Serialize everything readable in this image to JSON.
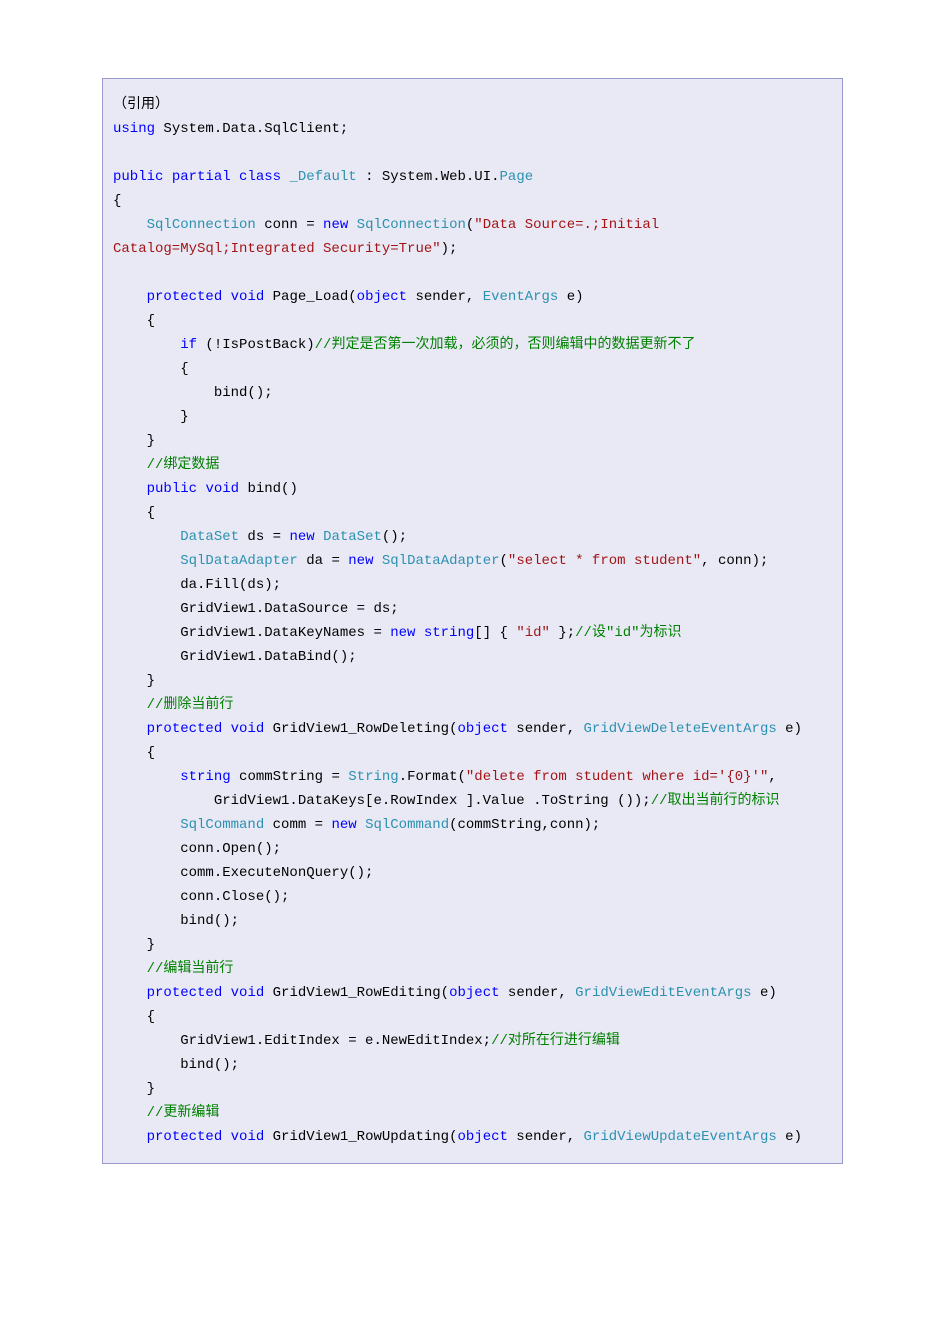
{
  "code": {
    "l01": [
      {
        "t": "（引用）",
        "c": "k-black"
      }
    ],
    "l02": [
      {
        "t": "using",
        "c": "k-blue"
      },
      {
        "t": " System.Data.SqlClient;",
        "c": "k-black"
      }
    ],
    "l03": [
      {
        "t": "",
        "c": "k-black"
      }
    ],
    "l04": [
      {
        "t": "public",
        "c": "k-blue"
      },
      {
        "t": " ",
        "c": "k-black"
      },
      {
        "t": "partial",
        "c": "k-blue"
      },
      {
        "t": " ",
        "c": "k-black"
      },
      {
        "t": "class",
        "c": "k-blue"
      },
      {
        "t": " ",
        "c": "k-black"
      },
      {
        "t": "_Default",
        "c": "k-teal"
      },
      {
        "t": " : System.Web.UI.",
        "c": "k-black"
      },
      {
        "t": "Page",
        "c": "k-teal"
      }
    ],
    "l05": [
      {
        "t": "{",
        "c": "k-black"
      }
    ],
    "l06": [
      {
        "t": "    ",
        "c": "k-black"
      },
      {
        "t": "SqlConnection",
        "c": "k-teal"
      },
      {
        "t": " conn = ",
        "c": "k-black"
      },
      {
        "t": "new",
        "c": "k-blue"
      },
      {
        "t": " ",
        "c": "k-black"
      },
      {
        "t": "SqlConnection",
        "c": "k-teal"
      },
      {
        "t": "(",
        "c": "k-black"
      },
      {
        "t": "\"Data Source=.;Initial ",
        "c": "k-red"
      }
    ],
    "l07": [
      {
        "t": "Catalog=MySql;Integrated Security=True\"",
        "c": "k-red"
      },
      {
        "t": ");",
        "c": "k-black"
      }
    ],
    "l08": [
      {
        "t": "",
        "c": "k-black"
      }
    ],
    "l09": [
      {
        "t": "    ",
        "c": "k-black"
      },
      {
        "t": "protected",
        "c": "k-blue"
      },
      {
        "t": " ",
        "c": "k-black"
      },
      {
        "t": "void",
        "c": "k-blue"
      },
      {
        "t": " Page_Load(",
        "c": "k-black"
      },
      {
        "t": "object",
        "c": "k-blue"
      },
      {
        "t": " sender, ",
        "c": "k-black"
      },
      {
        "t": "EventArgs",
        "c": "k-teal"
      },
      {
        "t": " e)",
        "c": "k-black"
      }
    ],
    "l10": [
      {
        "t": "    {",
        "c": "k-black"
      }
    ],
    "l11": [
      {
        "t": "        ",
        "c": "k-black"
      },
      {
        "t": "if",
        "c": "k-blue"
      },
      {
        "t": " (!IsPostBack)",
        "c": "k-black"
      },
      {
        "t": "//判定是否第一次加载，必须的，否则编辑中的数据更新不了",
        "c": "k-green"
      }
    ],
    "l12": [
      {
        "t": "        {",
        "c": "k-black"
      }
    ],
    "l13": [
      {
        "t": "            bind();",
        "c": "k-black"
      }
    ],
    "l14": [
      {
        "t": "        }",
        "c": "k-black"
      }
    ],
    "l15": [
      {
        "t": "    }",
        "c": "k-black"
      }
    ],
    "l16": [
      {
        "t": "    ",
        "c": "k-black"
      },
      {
        "t": "//绑定数据",
        "c": "k-green"
      }
    ],
    "l17": [
      {
        "t": "    ",
        "c": "k-black"
      },
      {
        "t": "public",
        "c": "k-blue"
      },
      {
        "t": " ",
        "c": "k-black"
      },
      {
        "t": "void",
        "c": "k-blue"
      },
      {
        "t": " bind()",
        "c": "k-black"
      }
    ],
    "l18": [
      {
        "t": "    {",
        "c": "k-black"
      }
    ],
    "l19": [
      {
        "t": "        ",
        "c": "k-black"
      },
      {
        "t": "DataSet",
        "c": "k-teal"
      },
      {
        "t": " ds = ",
        "c": "k-black"
      },
      {
        "t": "new",
        "c": "k-blue"
      },
      {
        "t": " ",
        "c": "k-black"
      },
      {
        "t": "DataSet",
        "c": "k-teal"
      },
      {
        "t": "();",
        "c": "k-black"
      }
    ],
    "l20": [
      {
        "t": "        ",
        "c": "k-black"
      },
      {
        "t": "SqlDataAdapter",
        "c": "k-teal"
      },
      {
        "t": " da = ",
        "c": "k-black"
      },
      {
        "t": "new",
        "c": "k-blue"
      },
      {
        "t": " ",
        "c": "k-black"
      },
      {
        "t": "SqlDataAdapter",
        "c": "k-teal"
      },
      {
        "t": "(",
        "c": "k-black"
      },
      {
        "t": "\"select * from student\"",
        "c": "k-red"
      },
      {
        "t": ", conn);",
        "c": "k-black"
      }
    ],
    "l21": [
      {
        "t": "        da.Fill(ds);",
        "c": "k-black"
      }
    ],
    "l22": [
      {
        "t": "        GridView1.DataSource = ds;",
        "c": "k-black"
      }
    ],
    "l23": [
      {
        "t": "        GridView1.DataKeyNames = ",
        "c": "k-black"
      },
      {
        "t": "new",
        "c": "k-blue"
      },
      {
        "t": " ",
        "c": "k-black"
      },
      {
        "t": "string",
        "c": "k-blue"
      },
      {
        "t": "[] { ",
        "c": "k-black"
      },
      {
        "t": "\"id\"",
        "c": "k-red"
      },
      {
        "t": " };",
        "c": "k-black"
      },
      {
        "t": "//设\"id\"为标识",
        "c": "k-green"
      }
    ],
    "l24": [
      {
        "t": "        GridView1.DataBind();",
        "c": "k-black"
      }
    ],
    "l25": [
      {
        "t": "    }",
        "c": "k-black"
      }
    ],
    "l26": [
      {
        "t": "    ",
        "c": "k-black"
      },
      {
        "t": "//删除当前行",
        "c": "k-green"
      }
    ],
    "l27": [
      {
        "t": "    ",
        "c": "k-black"
      },
      {
        "t": "protected",
        "c": "k-blue"
      },
      {
        "t": " ",
        "c": "k-black"
      },
      {
        "t": "void",
        "c": "k-blue"
      },
      {
        "t": " GridView1_RowDeleting(",
        "c": "k-black"
      },
      {
        "t": "object",
        "c": "k-blue"
      },
      {
        "t": " sender, ",
        "c": "k-black"
      },
      {
        "t": "GridViewDeleteEventArgs",
        "c": "k-teal"
      },
      {
        "t": " e)",
        "c": "k-black"
      }
    ],
    "l28": [
      {
        "t": "    {",
        "c": "k-black"
      }
    ],
    "l29": [
      {
        "t": "        ",
        "c": "k-black"
      },
      {
        "t": "string",
        "c": "k-blue"
      },
      {
        "t": " commString = ",
        "c": "k-black"
      },
      {
        "t": "String",
        "c": "k-teal"
      },
      {
        "t": ".Format(",
        "c": "k-black"
      },
      {
        "t": "\"delete from student where id='{0}'\"",
        "c": "k-red"
      },
      {
        "t": ",",
        "c": "k-black"
      }
    ],
    "l30": [
      {
        "t": "            GridView1.DataKeys[e.RowIndex ].Value .ToString ());",
        "c": "k-black"
      },
      {
        "t": "//取出当前行的标识",
        "c": "k-green"
      }
    ],
    "l31": [
      {
        "t": "        ",
        "c": "k-black"
      },
      {
        "t": "SqlCommand",
        "c": "k-teal"
      },
      {
        "t": " comm = ",
        "c": "k-black"
      },
      {
        "t": "new",
        "c": "k-blue"
      },
      {
        "t": " ",
        "c": "k-black"
      },
      {
        "t": "SqlCommand",
        "c": "k-teal"
      },
      {
        "t": "(commString,conn);",
        "c": "k-black"
      }
    ],
    "l32": [
      {
        "t": "        conn.Open();",
        "c": "k-black"
      }
    ],
    "l33": [
      {
        "t": "        comm.ExecuteNonQuery();",
        "c": "k-black"
      }
    ],
    "l34": [
      {
        "t": "        conn.Close();",
        "c": "k-black"
      }
    ],
    "l35": [
      {
        "t": "        bind();",
        "c": "k-black"
      }
    ],
    "l36": [
      {
        "t": "    }",
        "c": "k-black"
      }
    ],
    "l37": [
      {
        "t": "    ",
        "c": "k-black"
      },
      {
        "t": "//编辑当前行",
        "c": "k-green"
      }
    ],
    "l38": [
      {
        "t": "    ",
        "c": "k-black"
      },
      {
        "t": "protected",
        "c": "k-blue"
      },
      {
        "t": " ",
        "c": "k-black"
      },
      {
        "t": "void",
        "c": "k-blue"
      },
      {
        "t": " GridView1_RowEditing(",
        "c": "k-black"
      },
      {
        "t": "object",
        "c": "k-blue"
      },
      {
        "t": " sender, ",
        "c": "k-black"
      },
      {
        "t": "GridViewEditEventArgs",
        "c": "k-teal"
      },
      {
        "t": " e)",
        "c": "k-black"
      }
    ],
    "l39": [
      {
        "t": "    {",
        "c": "k-black"
      }
    ],
    "l40": [
      {
        "t": "        GridView1.EditIndex = e.NewEditIndex;",
        "c": "k-black"
      },
      {
        "t": "//对所在行进行编辑",
        "c": "k-green"
      }
    ],
    "l41": [
      {
        "t": "        bind();",
        "c": "k-black"
      }
    ],
    "l42": [
      {
        "t": "    }",
        "c": "k-black"
      }
    ],
    "l43": [
      {
        "t": "    ",
        "c": "k-black"
      },
      {
        "t": "//更新编辑",
        "c": "k-green"
      }
    ],
    "l44": [
      {
        "t": "    ",
        "c": "k-black"
      },
      {
        "t": "protected",
        "c": "k-blue"
      },
      {
        "t": " ",
        "c": "k-black"
      },
      {
        "t": "void",
        "c": "k-blue"
      },
      {
        "t": " GridView1_RowUpdating(",
        "c": "k-black"
      },
      {
        "t": "object",
        "c": "k-blue"
      },
      {
        "t": " sender, ",
        "c": "k-black"
      },
      {
        "t": "GridViewUpdateEventArgs",
        "c": "k-teal"
      },
      {
        "t": " e)",
        "c": "k-black"
      }
    ]
  },
  "lineOrder": [
    "l01",
    "l02",
    "l03",
    "l04",
    "l05",
    "l06",
    "l07",
    "l08",
    "l09",
    "l10",
    "l11",
    "l12",
    "l13",
    "l14",
    "l15",
    "l16",
    "l17",
    "l18",
    "l19",
    "l20",
    "l21",
    "l22",
    "l23",
    "l24",
    "l25",
    "l26",
    "l27",
    "l28",
    "l29",
    "l30",
    "l31",
    "l32",
    "l33",
    "l34",
    "l35",
    "l36",
    "l37",
    "l38",
    "l39",
    "l40",
    "l41",
    "l42",
    "l43",
    "l44"
  ]
}
